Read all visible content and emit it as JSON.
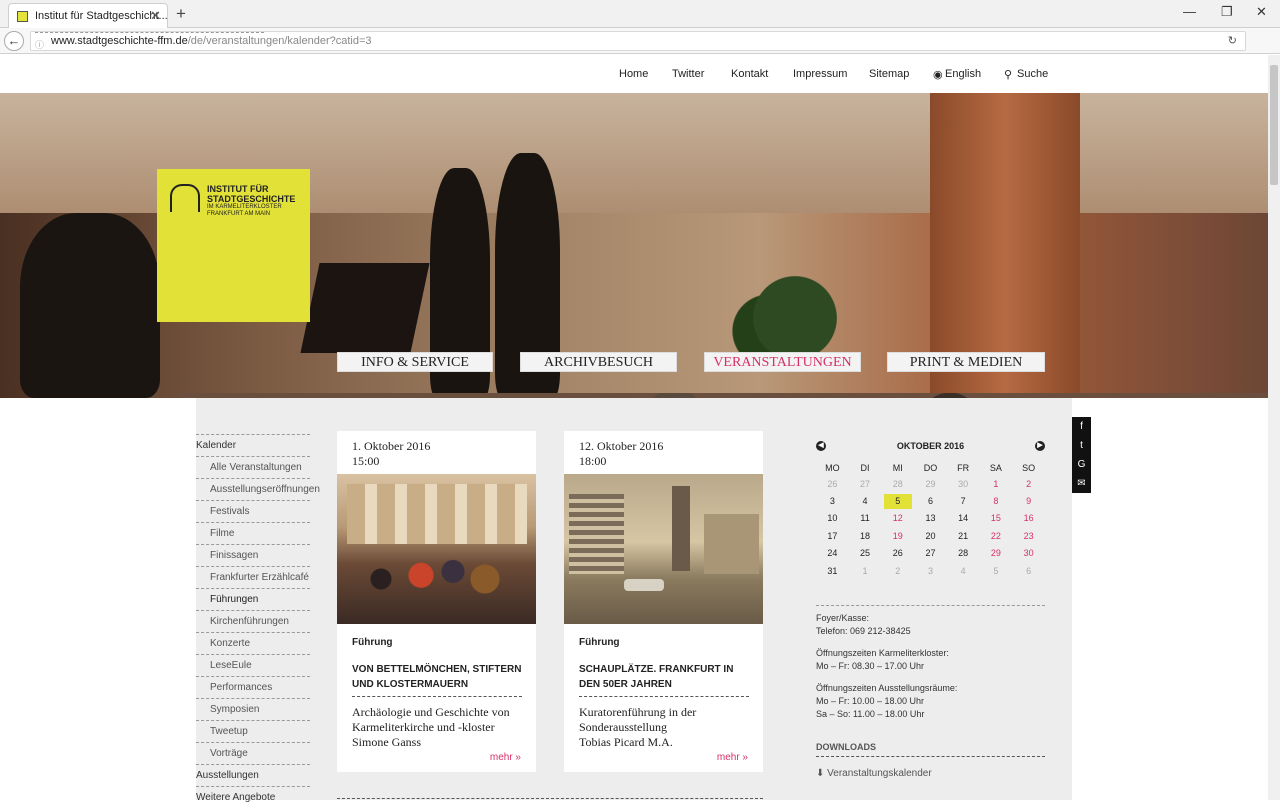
{
  "browser": {
    "tab_title": "Institut für Stadtgeschicht...",
    "url_domain": "www.stadtgeschichte-ffm.de",
    "url_path": "/de/veranstaltungen/kalender?catid=3"
  },
  "topnav": [
    "Home",
    "Twitter",
    "Kontakt",
    "Impressum",
    "Sitemap",
    "English",
    "Suche"
  ],
  "logo": {
    "line1": "INSTITUT FÜR",
    "line2": "STADTGESCHICHTE",
    "line3": "IM KARMELITERKLOSTER",
    "line4": "FRANKFURT AM MAIN"
  },
  "mainnav": [
    "INFO & SERVICE",
    "ARCHIVBESUCH",
    "VERANSTALTUNGEN",
    "PRINT & MEDIEN"
  ],
  "sidebar": {
    "head": "Kalender",
    "items": [
      "Alle Veranstaltungen",
      "Ausstellungseröffnungen",
      "Festivals",
      "Filme",
      "Finissagen",
      "Frankfurter Erzählcafé",
      "Führungen",
      "Kirchenführungen",
      "Konzerte",
      "LeseEule",
      "Performances",
      "Symposien",
      "Tweetup",
      "Vorträge"
    ],
    "after": [
      "Ausstellungen",
      "Weitere Angebote"
    ]
  },
  "events": [
    {
      "date": "1. Oktober 2016",
      "time": "15:00",
      "category": "Führung",
      "title": "VON BETTELMÖNCHEN, STIFTERN UND KLOSTERMAUERN",
      "desc1": "Archäologie und Geschichte von Karmeliterkirche und -kloster",
      "desc2": "Simone Ganss",
      "more": "mehr »"
    },
    {
      "date": "12. Oktober 2016",
      "time": "18:00",
      "category": "Führung",
      "title": "SCHAUPLÄTZE. FRANKFURT IN DEN 50ER JAHREN",
      "desc1": "Kuratorenführung in der Sonderausstellung",
      "desc2": "Tobias Picard M.A.",
      "more": "mehr »"
    }
  ],
  "calendar": {
    "month": "OKTOBER 2016",
    "weekdays": [
      "MO",
      "DI",
      "MI",
      "DO",
      "FR",
      "SA",
      "SO"
    ],
    "weeks": [
      [
        "26",
        "27",
        "28",
        "29",
        "30",
        "1",
        "2"
      ],
      [
        "3",
        "4",
        "5",
        "6",
        "7",
        "8",
        "9"
      ],
      [
        "10",
        "11",
        "12",
        "13",
        "14",
        "15",
        "16"
      ],
      [
        "17",
        "18",
        "19",
        "20",
        "21",
        "22",
        "23"
      ],
      [
        "24",
        "25",
        "26",
        "27",
        "28",
        "29",
        "30"
      ],
      [
        "31",
        "1",
        "2",
        "3",
        "4",
        "5",
        "6"
      ]
    ],
    "highlight_color": "#d6306b",
    "today_color": "#e2e137"
  },
  "info": {
    "foyer_label": "Foyer/Kasse:",
    "foyer_phone": "Telefon: 069 212-38425",
    "kloster_label": "Öffnungszeiten Karmeliterkloster:",
    "kloster_hours": "Mo – Fr: 08.30 – 17.00 Uhr",
    "ausst_label": "Öffnungszeiten Ausstellungsräume:",
    "ausst_hours1": "Mo – Fr: 10.00 – 18.00 Uhr",
    "ausst_hours2": "Sa – So: 11.00 – 18.00 Uhr"
  },
  "downloads": {
    "head": "DOWNLOADS",
    "item": "Veranstaltungskalender"
  }
}
